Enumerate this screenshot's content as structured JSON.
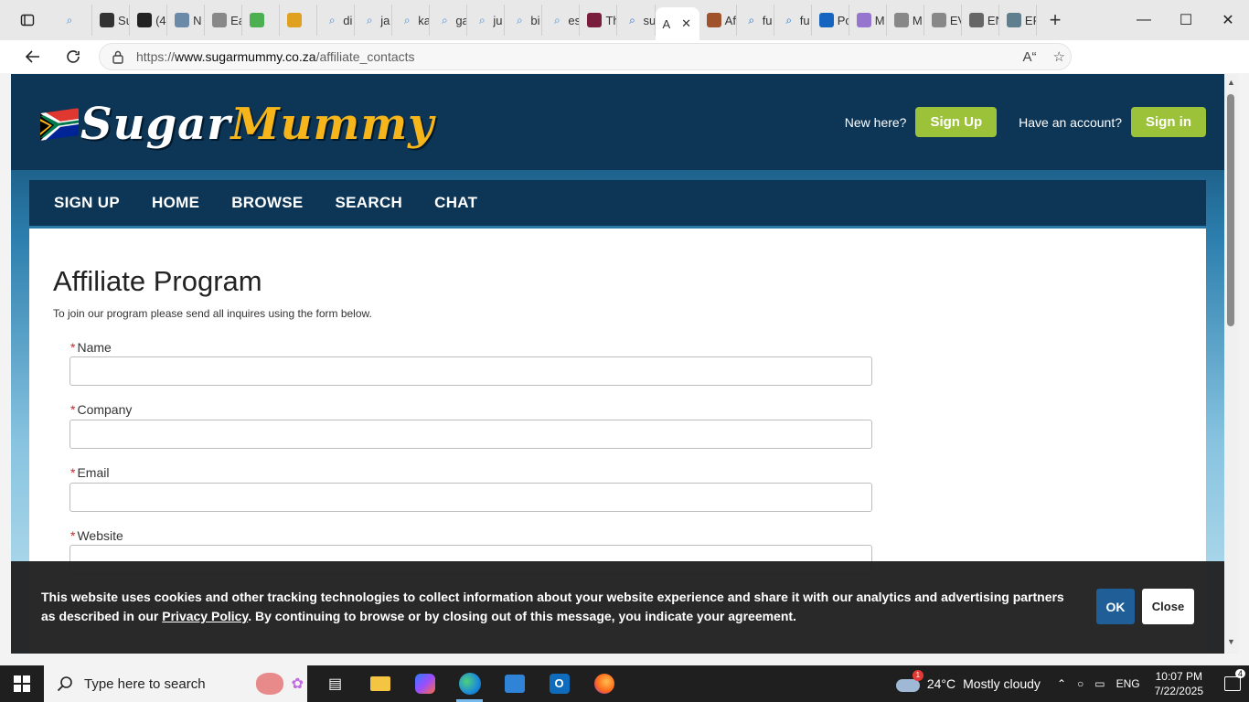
{
  "browser": {
    "tabs": [
      {
        "label": "",
        "icon": "search-icon",
        "color": "#4a8fd8"
      },
      {
        "label": "Su",
        "icon": "openai-icon",
        "color": "#333333"
      },
      {
        "label": "(4",
        "icon": "b-icon",
        "color": "#222222"
      },
      {
        "label": "N",
        "icon": "ai-icon",
        "color": "#6b8aa8"
      },
      {
        "label": "Ea",
        "icon": "n-icon",
        "color": "#888888"
      },
      {
        "label": "",
        "icon": "globe-icon",
        "color": "#4caf50"
      },
      {
        "label": "",
        "icon": "shield-icon",
        "color": "#e0a020"
      },
      {
        "label": "di",
        "icon": "search-icon",
        "color": "#4a8fd8"
      },
      {
        "label": "ja",
        "icon": "search-icon",
        "color": "#4a8fd8"
      },
      {
        "label": "ka",
        "icon": "search-icon",
        "color": "#4a8fd8"
      },
      {
        "label": "ga",
        "icon": "search-icon",
        "color": "#4a8fd8"
      },
      {
        "label": "ju",
        "icon": "search-icon",
        "color": "#4a8fd8"
      },
      {
        "label": "bi",
        "icon": "search-icon",
        "color": "#4a8fd8"
      },
      {
        "label": "es",
        "icon": "search-icon",
        "color": "#4a8fd8"
      },
      {
        "label": "Th",
        "icon": "crown-icon",
        "color": "#7a1c3c"
      },
      {
        "label": "su",
        "icon": "search-icon",
        "color": "#1a6fd1"
      },
      {
        "label": "A",
        "icon": "",
        "color": "#ffffff",
        "active": true
      },
      {
        "label": "Af",
        "icon": "ball-icon",
        "color": "#a0522d"
      },
      {
        "label": "fu",
        "icon": "search-icon",
        "color": "#1a6fd1"
      },
      {
        "label": "fu",
        "icon": "search-icon",
        "color": "#1a6fd1"
      },
      {
        "label": "Po",
        "icon": "xf-icon",
        "color": "#1565c0"
      },
      {
        "label": "M",
        "icon": "e-icon",
        "color": "#9575cd"
      },
      {
        "label": "M",
        "icon": "sp-icon",
        "color": "#888888"
      },
      {
        "label": "EV",
        "icon": "sp-icon",
        "color": "#888888"
      },
      {
        "label": "EN",
        "icon": "wordpress-icon",
        "color": "#666666"
      },
      {
        "label": "EF",
        "icon": "arrows-icon",
        "color": "#5f7f8f"
      }
    ],
    "url_prefix": "https://",
    "url_host": "www.sugarmummy.co.za",
    "url_path": "/affiliate_contacts"
  },
  "site": {
    "logo_white": "Sugar",
    "logo_yellow": "Mummy",
    "new_here": "New here?",
    "signup_btn": "Sign Up",
    "have_account": "Have an account?",
    "signin_btn": "Sign in",
    "nav": [
      "SIGN UP",
      "HOME",
      "BROWSE",
      "SEARCH",
      "CHAT"
    ],
    "title": "Affiliate Program",
    "intro": "To join our program please send all inquires using the form below.",
    "required_mark": "*",
    "fields": [
      "Name",
      "Company",
      "Email",
      "Website"
    ]
  },
  "cookie": {
    "text_before": "This website uses cookies and other tracking technologies to collect information about your website experience and share it with our analytics and advertising partners as described in our ",
    "link_text": "Privacy Policy",
    "text_after": ". By continuing to browse or by closing out of this message, you indicate your agreement.",
    "ok": "OK",
    "close": "Close"
  },
  "taskbar": {
    "search_placeholder": "Type here to search",
    "weather_temp": "24°C",
    "weather_desc": "Mostly cloudy",
    "weather_badge": "1",
    "lang": "ENG",
    "time": "10:07 PM",
    "date": "7/22/2025",
    "notifications": "4"
  },
  "colors": {
    "site_dark_blue": "#0c3556",
    "accent_green": "#9cc23a",
    "logo_yellow": "#f6b61b",
    "ok_blue": "#1f5e96"
  }
}
